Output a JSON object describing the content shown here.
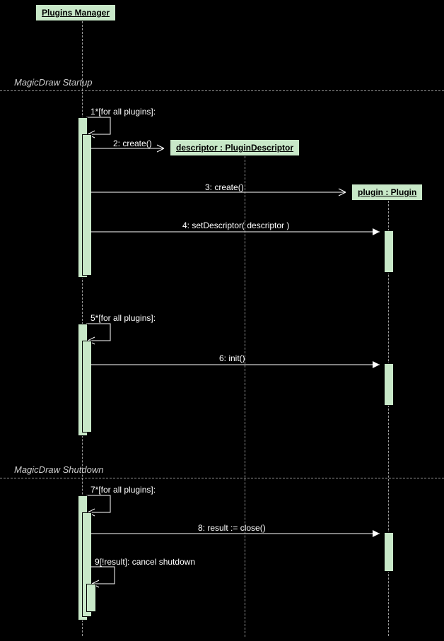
{
  "lifelines": {
    "manager": "Plugins Manager",
    "descriptor": "descriptor : PluginDescriptor",
    "plugin": "plugin : Plugin"
  },
  "fragments": {
    "startup": "MagicDraw Startup",
    "shutdown": "MagicDraw Shutdown"
  },
  "messages": {
    "m1": "1*[for all plugins]:",
    "m2": "2: create()",
    "m3": "3: create()",
    "m4": "4: setDescriptor( descriptor )",
    "m5": "5*[for all plugins]:",
    "m6": "6: init()",
    "m7": "7*[for all plugins]:",
    "m8": "8: result := close()",
    "m9": "9[!result]: cancel shutdown"
  },
  "chart_data": {
    "type": "sequence_diagram",
    "lifelines": [
      {
        "id": "manager",
        "name": "Plugins Manager"
      },
      {
        "id": "descriptor",
        "name": "descriptor : PluginDescriptor"
      },
      {
        "id": "plugin",
        "name": "plugin : Plugin"
      }
    ],
    "fragments": [
      {
        "label": "MagicDraw Startup",
        "covers_messages": [
          1,
          2,
          3,
          4,
          5,
          6
        ]
      },
      {
        "label": "MagicDraw Shutdown",
        "covers_messages": [
          7,
          8,
          9
        ]
      }
    ],
    "messages": [
      {
        "n": 1,
        "from": "manager",
        "to": "manager",
        "label": "1*[for all plugins]:",
        "kind": "self"
      },
      {
        "n": 2,
        "from": "manager",
        "to": "descriptor",
        "label": "2: create()",
        "kind": "create"
      },
      {
        "n": 3,
        "from": "manager",
        "to": "plugin",
        "label": "3: create()",
        "kind": "create"
      },
      {
        "n": 4,
        "from": "manager",
        "to": "plugin",
        "label": "4: setDescriptor( descriptor )",
        "kind": "call"
      },
      {
        "n": 5,
        "from": "manager",
        "to": "manager",
        "label": "5*[for all plugins]:",
        "kind": "self"
      },
      {
        "n": 6,
        "from": "manager",
        "to": "plugin",
        "label": "6: init()",
        "kind": "call"
      },
      {
        "n": 7,
        "from": "manager",
        "to": "manager",
        "label": "7*[for all plugins]:",
        "kind": "self"
      },
      {
        "n": 8,
        "from": "manager",
        "to": "plugin",
        "label": "8: result := close()",
        "kind": "call"
      },
      {
        "n": 9,
        "from": "manager",
        "to": "manager",
        "label": "9[!result]: cancel shutdown",
        "kind": "self"
      }
    ]
  }
}
